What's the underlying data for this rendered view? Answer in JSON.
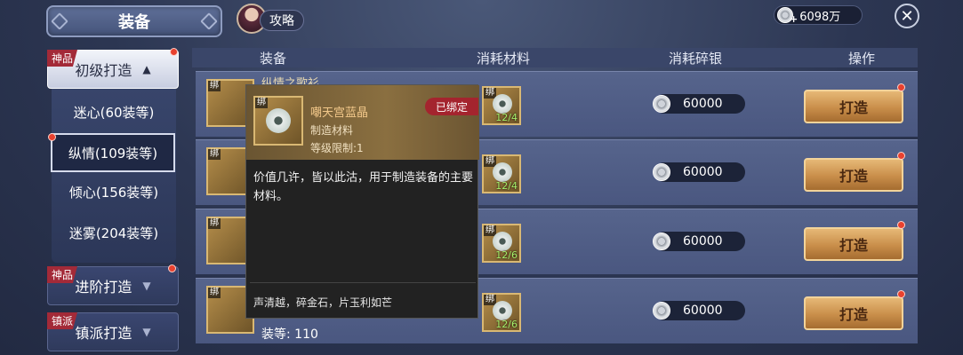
{
  "header": {
    "title": "装备",
    "guide_label": "攻略",
    "currency_value": "6098万",
    "currency_plus": "+",
    "close_glyph": "✕"
  },
  "sidebar": {
    "categories": [
      {
        "tag": "神品",
        "label": "初级打造",
        "arrow": "▲",
        "expanded": true
      },
      {
        "tag": "神品",
        "label": "进阶打造",
        "arrow": "▼",
        "expanded": false
      },
      {
        "tag": "镇派",
        "label": "镇派打造",
        "arrow": "▼",
        "expanded": false
      }
    ],
    "subitems": [
      {
        "label": "迷心(60装等)"
      },
      {
        "label": "纵情(109装等)",
        "selected": true
      },
      {
        "label": "倾心(156装等)"
      },
      {
        "label": "迷雾(204装等)"
      }
    ]
  },
  "table": {
    "headers": {
      "equipment": "装备",
      "materials": "消耗材料",
      "silver": "消耗碎银",
      "action": "操作"
    },
    "bind_label": "绑",
    "forge_label": "打造",
    "rows": [
      {
        "name": "纵情之歌衫",
        "material_count": "12/4",
        "cost": "60000"
      },
      {
        "name": "",
        "material_count": "12/4",
        "cost": "60000"
      },
      {
        "name": "",
        "material_count": "12/6",
        "cost": "60000"
      },
      {
        "name": "",
        "material_count": "12/6",
        "cost": "60000",
        "sub": "装等: 110"
      }
    ]
  },
  "tooltip": {
    "bind_label": "绑",
    "name": "嘲天宫蓝晶",
    "type": "制造材料",
    "level": "等级限制:1",
    "bound_badge": "已绑定",
    "description": "价值几许，皆以此沽，用于制造装备的主要材料。",
    "flavor": "声清越，碎金石，片玉利如芒"
  },
  "colors": {
    "accent_red": "#e8412f",
    "forge_gold": "#c98e4a",
    "count_green": "#a6f06a"
  }
}
